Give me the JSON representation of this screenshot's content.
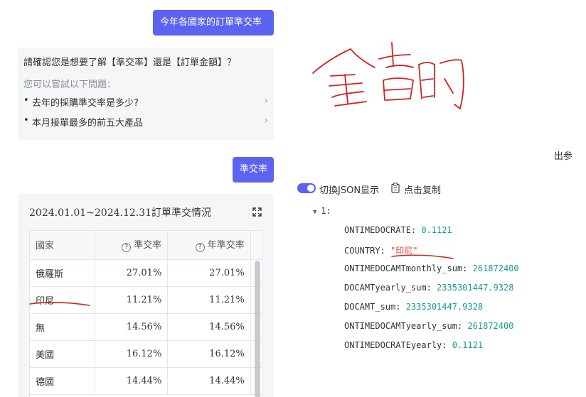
{
  "chat": {
    "user_messages": [
      "今年各國家的訂單準交率",
      "準交率"
    ],
    "bot_reply": {
      "question": "請確認您是想要了解【準交率】還是【訂單金額】？",
      "hint": "您可以嘗試以下問題：",
      "suggestions": [
        "去年的採購準交率是多少?",
        "本月接單最多的前五大產品"
      ]
    }
  },
  "table_card": {
    "title": "2024.01.01~2024.12.31訂單準交情況",
    "columns": [
      "國家",
      "準交率",
      "年準交率"
    ],
    "rows": [
      [
        "俄羅斯",
        "27.01%",
        "27.01%"
      ],
      [
        "印尼",
        "11.21%",
        "11.21%"
      ],
      [
        "無",
        "14.56%",
        "14.56%"
      ],
      [
        "美國",
        "16.12%",
        "16.12%"
      ],
      [
        "德國",
        "14.44%",
        "14.44%"
      ]
    ]
  },
  "output_panel": {
    "label": "出参",
    "toggle_label": "切換JSON显示",
    "copy_label": "点击复制",
    "json": {
      "index_label": "1:",
      "entries": [
        {
          "key": "ONTIMEDOCRATE",
          "value": "0.1121",
          "type": "number"
        },
        {
          "key": "COUNTRY",
          "value": "\"印尼\"",
          "type": "string"
        },
        {
          "key": "ONTIMEDOCAMTmonthly_sum",
          "value": "261872400",
          "type": "number"
        },
        {
          "key": "DOCAMTyearly_sum",
          "value": "2335301447.9328",
          "type": "number"
        },
        {
          "key": "DOCAMT_sum",
          "value": "2335301447.9328",
          "type": "number"
        },
        {
          "key": "ONTIMEDOCAMTyearly_sum",
          "value": "261872400",
          "type": "number"
        },
        {
          "key": "ONTIMEDOCRATEyearly",
          "value": "0.1121",
          "type": "number"
        }
      ]
    }
  },
  "colors": {
    "accent": "#5b63f0",
    "json_number": "#1a9a8a",
    "json_string": "#e0453b",
    "annotation_ink": "#d42020"
  }
}
